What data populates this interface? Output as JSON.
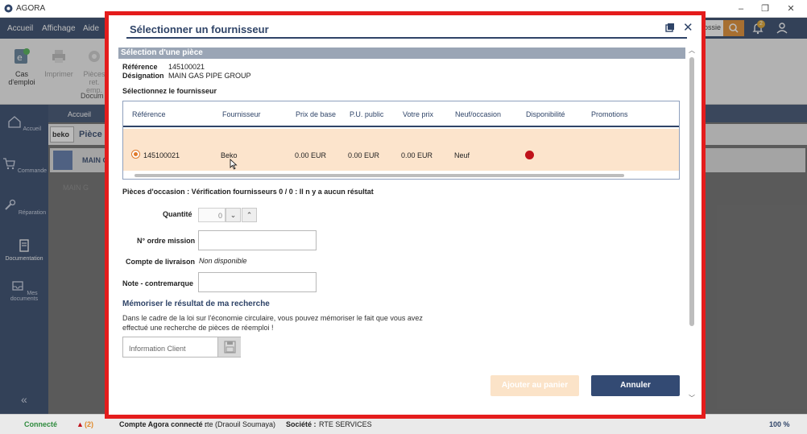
{
  "app": {
    "title": "AGORA"
  },
  "menu": {
    "items": [
      "Accueil",
      "Affichage",
      "Aide"
    ],
    "search_partial": "ossie",
    "notif_count": "2"
  },
  "ribbon": {
    "cas_label": "Cas d'emploi",
    "imprimer_label": "Imprimer",
    "pieces_label": "Pièces ret. emp.",
    "group_label": "Docum"
  },
  "sidebar": {
    "items": [
      "Accueil",
      "Commande",
      "Réparation",
      "Documentation",
      "Mes documents"
    ]
  },
  "background": {
    "tab_label": "Accueil",
    "brand": "beko",
    "piece_title": "Pièce :",
    "main_row": "MAIN G",
    "chip": "MAIN G"
  },
  "status": {
    "connected": "Connecté",
    "warnings": "(2)",
    "account_label": "Compte Agora connecté :",
    "account_value": "rte (Draouil Soumaya)",
    "company_label": "Société :",
    "company_value": "RTE SERVICES",
    "zoom": "100 %"
  },
  "dialog": {
    "title": "Sélectionner un fournisseur",
    "section_title": "Sélection d'une pièce",
    "ref_label": "Référence",
    "ref_value": "145100021",
    "desig_label": "Désignation",
    "desig_value": "MAIN GAS PIPE GROUP",
    "select_supplier": "Sélectionnez le fournisseur",
    "columns": [
      "Référence",
      "Fournisseur",
      "Prix de base",
      "P.U. public",
      "Votre prix",
      "Neuf/occasion",
      "Disponibilité",
      "Promotions"
    ],
    "row": {
      "reference": "145100021",
      "fournisseur": "Beko",
      "prix_base": "0.00 EUR",
      "pu_public": "0.00 EUR",
      "votre_prix": "0.00 EUR",
      "etat": "Neuf",
      "dispo_color": "#c0121a"
    },
    "occasion_text": "Pièces d'occasion : Vérification fournisseurs 0 / 0 : Il n y a aucun résultat",
    "quantite_label": "Quantité",
    "quantite_value": "0",
    "ordre_label": "N° ordre mission",
    "compte_label": "Compte de livraison",
    "compte_value": "Non disponible",
    "note_label": "Note - contremarque",
    "memo_title": "Mémoriser le résultat de ma recherche",
    "memo_text": "Dans le cadre de la loi sur l'économie circulaire, vous pouvez mémoriser le fait que vous avez effectué une recherche de pièces de réemploi !",
    "info_placeholder": "Information Client",
    "btn_add": "Ajouter au panier",
    "btn_cancel": "Annuler"
  },
  "colors": {
    "navy": "#2f4468",
    "accent_orange": "#e08a2b",
    "highlight_red": "#e41c1c",
    "selected_row": "#fce4cc"
  }
}
